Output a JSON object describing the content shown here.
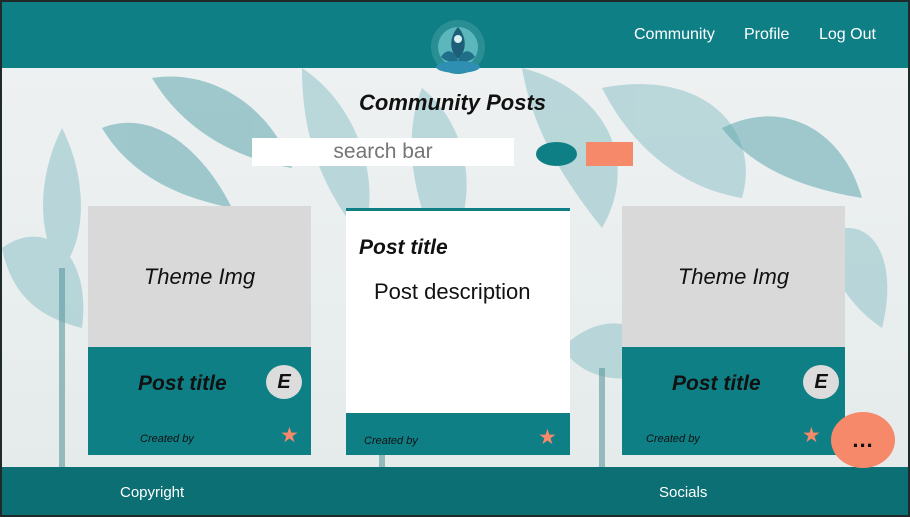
{
  "header": {
    "nav": [
      "Community",
      "Profile",
      "Log Out"
    ]
  },
  "main": {
    "title": "Community Posts",
    "search_placeholder": "search bar"
  },
  "cards": [
    {
      "image_label": "Theme Img",
      "title": "Post title",
      "badge": "E",
      "created_by": "Created by"
    },
    {
      "title": "Post title",
      "description": "Post description",
      "created_by": "Created by"
    },
    {
      "image_label": "Theme Img",
      "title": "Post title",
      "badge": "E",
      "created_by": "Created by"
    }
  ],
  "fab": {
    "label": "..."
  },
  "footer": {
    "left": "Copyright",
    "right": "Socials"
  },
  "icons": {
    "star": "star-icon",
    "logo": "lotus-logo"
  },
  "colors": {
    "primary": "#0f7f86",
    "footer": "#0b6f73",
    "accent": "#f5896a",
    "card_gray": "#d9d9d9"
  }
}
